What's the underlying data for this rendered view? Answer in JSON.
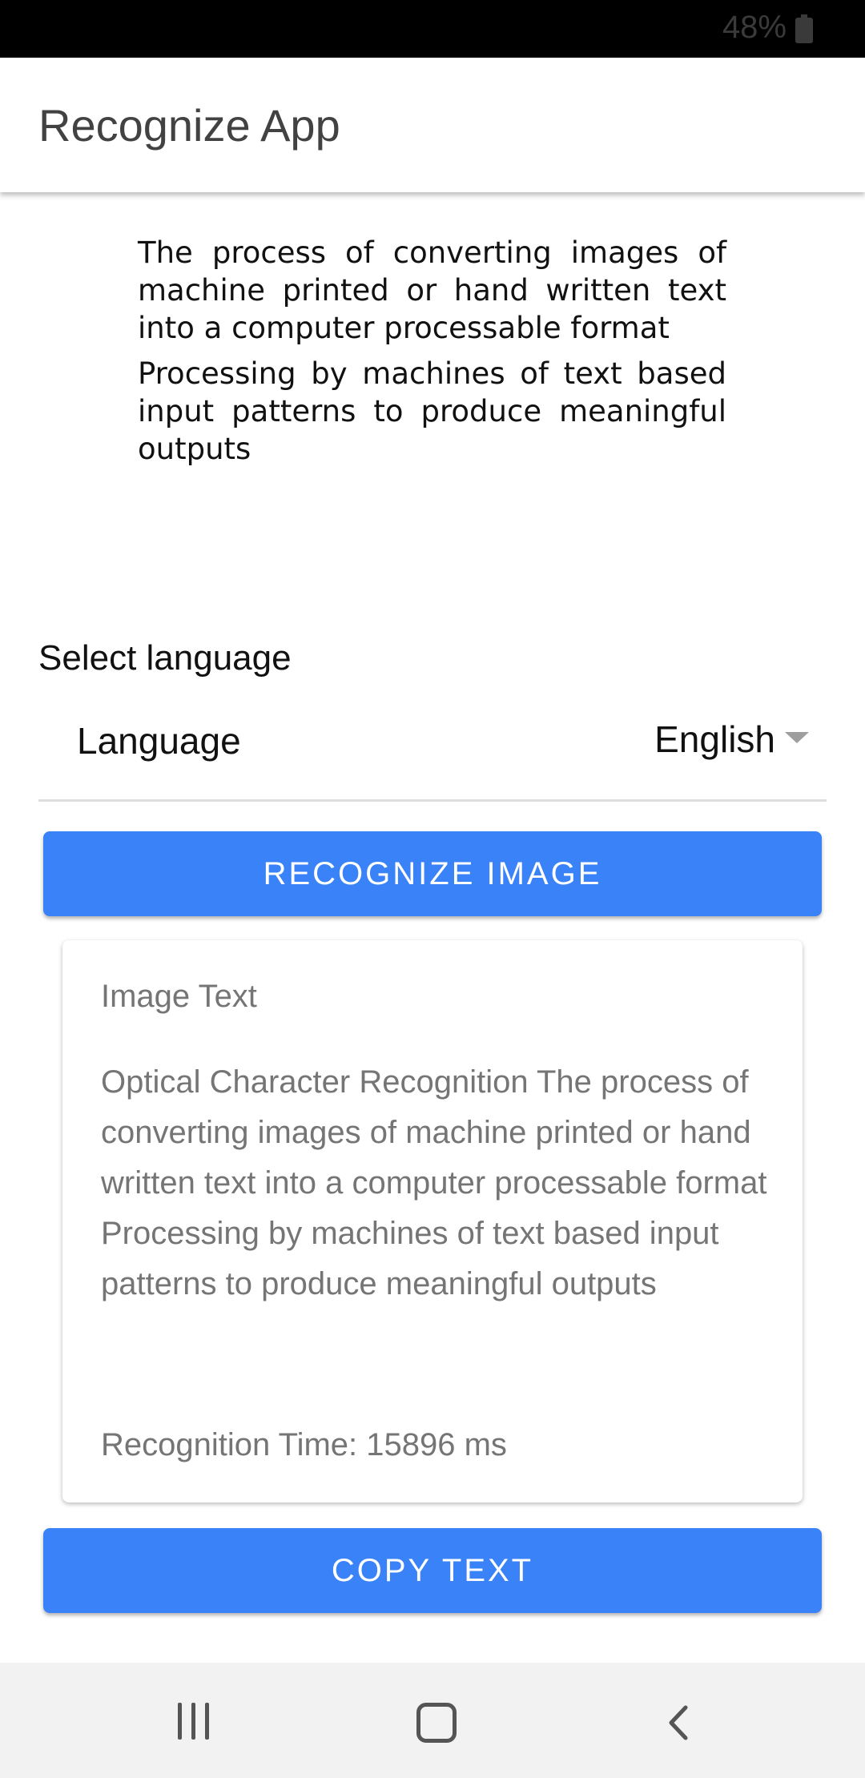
{
  "status_bar": {
    "battery_percent": "48%",
    "battery_icon": "battery-icon"
  },
  "app_bar": {
    "title": "Recognize App"
  },
  "source_image": {
    "paragraphs": [
      "The process of converting images of machine printed or hand written text into a computer processable format",
      "Processing by machines of text based input patterns to produce meaningful outputs"
    ]
  },
  "language": {
    "section_label": "Select language",
    "field_label": "Language",
    "selected": "English",
    "dropdown_icon": "chevron-down-icon"
  },
  "buttons": {
    "recognize": "RECOGNIZE IMAGE",
    "copy": "COPY TEXT",
    "color": "#3a82f7"
  },
  "result_card": {
    "title": "Image Text",
    "text": "Optical Character Recognition The process of converting images of machine printed or hand written text into a computer processable format Processing by machines of text based input patterns to produce meaningful outputs",
    "time": "Recognition Time: 15896 ms"
  },
  "nav_bar": {
    "recents_icon": "recents-icon",
    "home_icon": "home-icon",
    "back_icon": "back-icon"
  }
}
